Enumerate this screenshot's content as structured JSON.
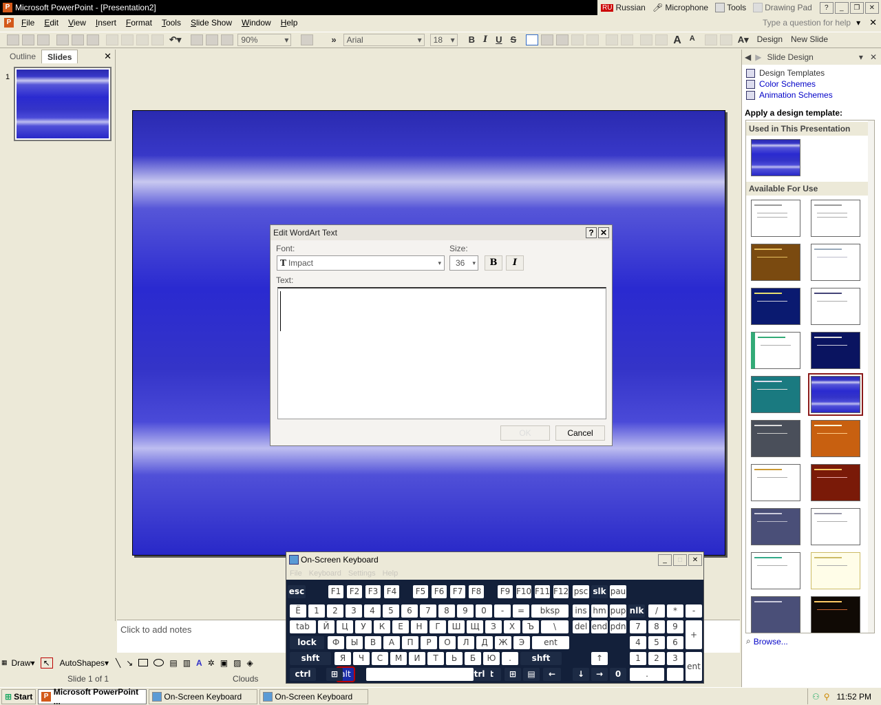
{
  "window": {
    "title": "Microsoft PowerPoint - [Presentation2]"
  },
  "langbar": {
    "lang_code": "RU",
    "lang_name": "Russian",
    "microphone": "Microphone",
    "tools": "Tools",
    "drawing_pad": "Drawing Pad"
  },
  "menu": {
    "items": [
      "File",
      "Edit",
      "View",
      "Insert",
      "Format",
      "Tools",
      "Slide Show",
      "Window",
      "Help"
    ],
    "help_placeholder": "Type a question for help"
  },
  "toolbar": {
    "zoom": "90%",
    "font": "Arial",
    "size": "18",
    "bold": "B",
    "italic": "I",
    "underline": "U",
    "shadow": "S",
    "design": "Design",
    "new_slide": "New Slide"
  },
  "left_pane": {
    "tab_outline": "Outline",
    "tab_slides": "Slides",
    "slide_number": "1"
  },
  "notes": {
    "placeholder": "Click to add notes"
  },
  "drawbar": {
    "draw": "Draw",
    "autoshapes": "AutoShapes"
  },
  "status": {
    "slide": "Slide 1 of 1",
    "design": "Clouds"
  },
  "task_pane": {
    "title": "Slide Design",
    "links": [
      "Design Templates",
      "Color Schemes",
      "Animation Schemes"
    ],
    "apply_label": "Apply a design template:",
    "used_header": "Used in This Presentation",
    "available_header": "Available For Use",
    "browse": "Browse..."
  },
  "dialog": {
    "title": "Edit WordArt Text",
    "help_btn": "?",
    "close_btn": "✕",
    "font_label": "Font:",
    "font_value": "Impact",
    "size_label": "Size:",
    "size_value": "36",
    "bold": "B",
    "italic": "I",
    "text_label": "Text:",
    "ok": "OK",
    "cancel": "Cancel"
  },
  "osk": {
    "title": "On-Screen Keyboard",
    "menu": [
      "File",
      "Keyboard",
      "Settings",
      "Help"
    ],
    "rows": [
      [
        "esc",
        "F1",
        "F2",
        "F3",
        "F4",
        "F5",
        "F6",
        "F7",
        "F8",
        "F9",
        "F10",
        "F11",
        "F12",
        "psc",
        "slk",
        "pau"
      ],
      [
        "Ё",
        "1",
        "2",
        "3",
        "4",
        "5",
        "6",
        "7",
        "8",
        "9",
        "0",
        "-",
        "=",
        "bksp",
        "ins",
        "hm",
        "pup",
        "nlk",
        "/",
        "*",
        "-"
      ],
      [
        "tab",
        "Й",
        "Ц",
        "У",
        "К",
        "Е",
        "Н",
        "Г",
        "Ш",
        "Щ",
        "З",
        "Х",
        "Ъ",
        "\\",
        "del",
        "end",
        "pdn",
        "7",
        "8",
        "9",
        "+"
      ],
      [
        "lock",
        "Ф",
        "Ы",
        "В",
        "А",
        "П",
        "Р",
        "О",
        "Л",
        "Д",
        "Ж",
        "Э",
        "ent",
        "4",
        "5",
        "6"
      ],
      [
        "shft",
        "Я",
        "Ч",
        "С",
        "М",
        "И",
        "Т",
        "Ь",
        "Б",
        "Ю",
        ".",
        "shft",
        "↑",
        "1",
        "2",
        "3",
        "ent"
      ],
      [
        "ctrl",
        "alt",
        "alt",
        "ctrl",
        "←",
        "↓",
        "→",
        "0",
        "."
      ]
    ]
  },
  "taskbar": {
    "start": "Start",
    "items": [
      "Microsoft PowerPoint ...",
      "On-Screen Keyboard",
      "On-Screen Keyboard"
    ],
    "clock": "11:52 PM"
  },
  "colors": {
    "slide_blue": "#2a2ac0",
    "osk_bg": "#13203a",
    "link_blue": "#0000c8",
    "selected_template_outline": "#8b1a1a"
  }
}
